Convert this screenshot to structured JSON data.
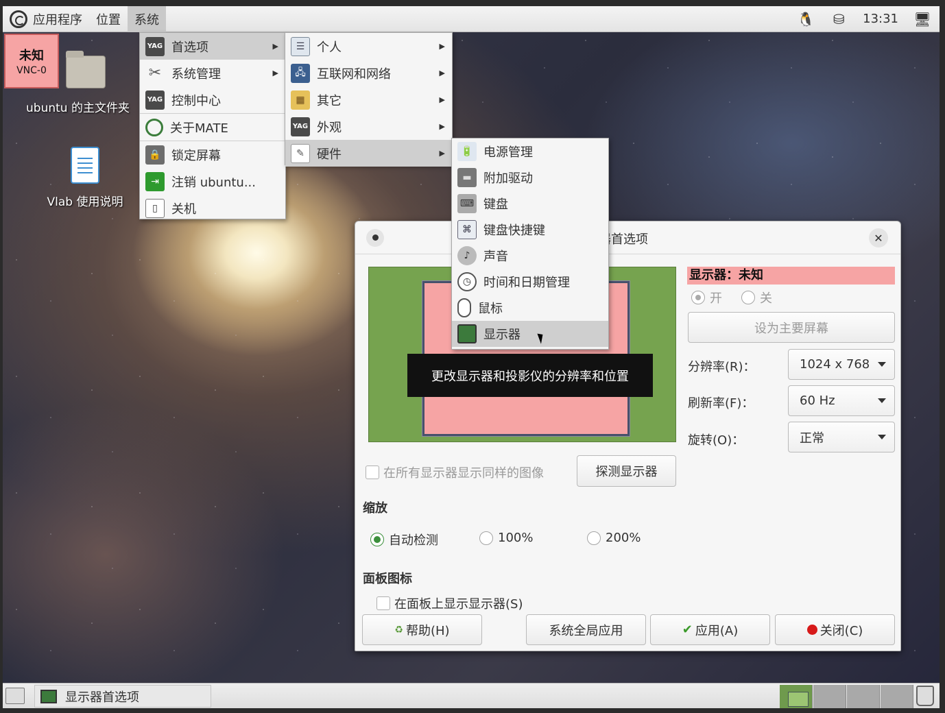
{
  "top_panel": {
    "menus": [
      {
        "label": "应用程序"
      },
      {
        "label": "位置"
      },
      {
        "label": "系统"
      }
    ],
    "clock": "13:31"
  },
  "desktop": {
    "vnc_badge": {
      "line1": "未知",
      "line2": "VNC-0"
    },
    "icons": [
      {
        "label": "ubuntu 的主文件夹"
      },
      {
        "label": "Vlab 使用说明"
      }
    ]
  },
  "system_menu": {
    "items": [
      {
        "label": "首选项",
        "icon": "preferences-icon",
        "submenu": true
      },
      {
        "label": "系统管理",
        "icon": "tools-icon",
        "submenu": true
      },
      {
        "label": "控制中心",
        "icon": "control-center-icon"
      },
      {
        "label": "关于MATE",
        "icon": "mate-logo-icon"
      },
      {
        "label": "锁定屏幕",
        "icon": "lock-screen-icon"
      },
      {
        "label": "注销 ubuntu...",
        "icon": "logout-icon"
      },
      {
        "label": "关机",
        "icon": "power-icon"
      }
    ]
  },
  "preferences_menu": {
    "items": [
      {
        "label": "个人",
        "icon": "personal-icon",
        "submenu": true
      },
      {
        "label": "互联网和网络",
        "icon": "network-icon",
        "submenu": true
      },
      {
        "label": "其它",
        "icon": "other-icon",
        "submenu": true
      },
      {
        "label": "外观",
        "icon": "appearance-icon",
        "submenu": true
      },
      {
        "label": "硬件",
        "icon": "hardware-icon",
        "submenu": true
      }
    ]
  },
  "hardware_menu": {
    "items": [
      {
        "label": "电源管理",
        "icon": "power-management-icon"
      },
      {
        "label": "附加驱动",
        "icon": "drivers-icon"
      },
      {
        "label": "键盘",
        "icon": "keyboard-icon"
      },
      {
        "label": "键盘快捷键",
        "icon": "keyboard-shortcuts-icon"
      },
      {
        "label": "声音",
        "icon": "sound-icon"
      },
      {
        "label": "时间和日期管理",
        "icon": "clock-icon"
      },
      {
        "label": "鼠标",
        "icon": "mouse-icon"
      },
      {
        "label": "显示器",
        "icon": "display-icon"
      }
    ]
  },
  "tooltip": "更改显示器和投影仪的分辨率和位置",
  "dialog": {
    "title_fragment": "器首选项",
    "monitor_label": "未知",
    "display_header": "显示器：未知",
    "power_on": "开",
    "power_off": "关",
    "set_primary": "设为主要屏幕",
    "resolution_label": "分辨率(R)：",
    "resolution_value": "1024 x 768",
    "refresh_label": "刷新率(F)：",
    "refresh_value": "60 Hz",
    "rotation_label": "旋转(O)：",
    "rotation_value": "正常",
    "mirror_label": "在所有显示器显示同样的图像",
    "detect_button": "探测显示器",
    "scale_heading": "缩放",
    "scale_options": [
      "自动检测",
      "100%",
      "200%"
    ],
    "scale_selected": "自动检测",
    "panel_heading": "面板图标",
    "panel_checkbox": "在面板上显示显示器(S)",
    "buttons": {
      "help": "帮助(H)",
      "system_wide": "系统全局应用",
      "apply": "应用(A)",
      "close": "关闭(C)"
    },
    "colors": {
      "monitor": "#f6a4a4",
      "preview_bg": "#76a34f"
    }
  },
  "bottom_panel": {
    "task_label": "显示器首选项"
  }
}
